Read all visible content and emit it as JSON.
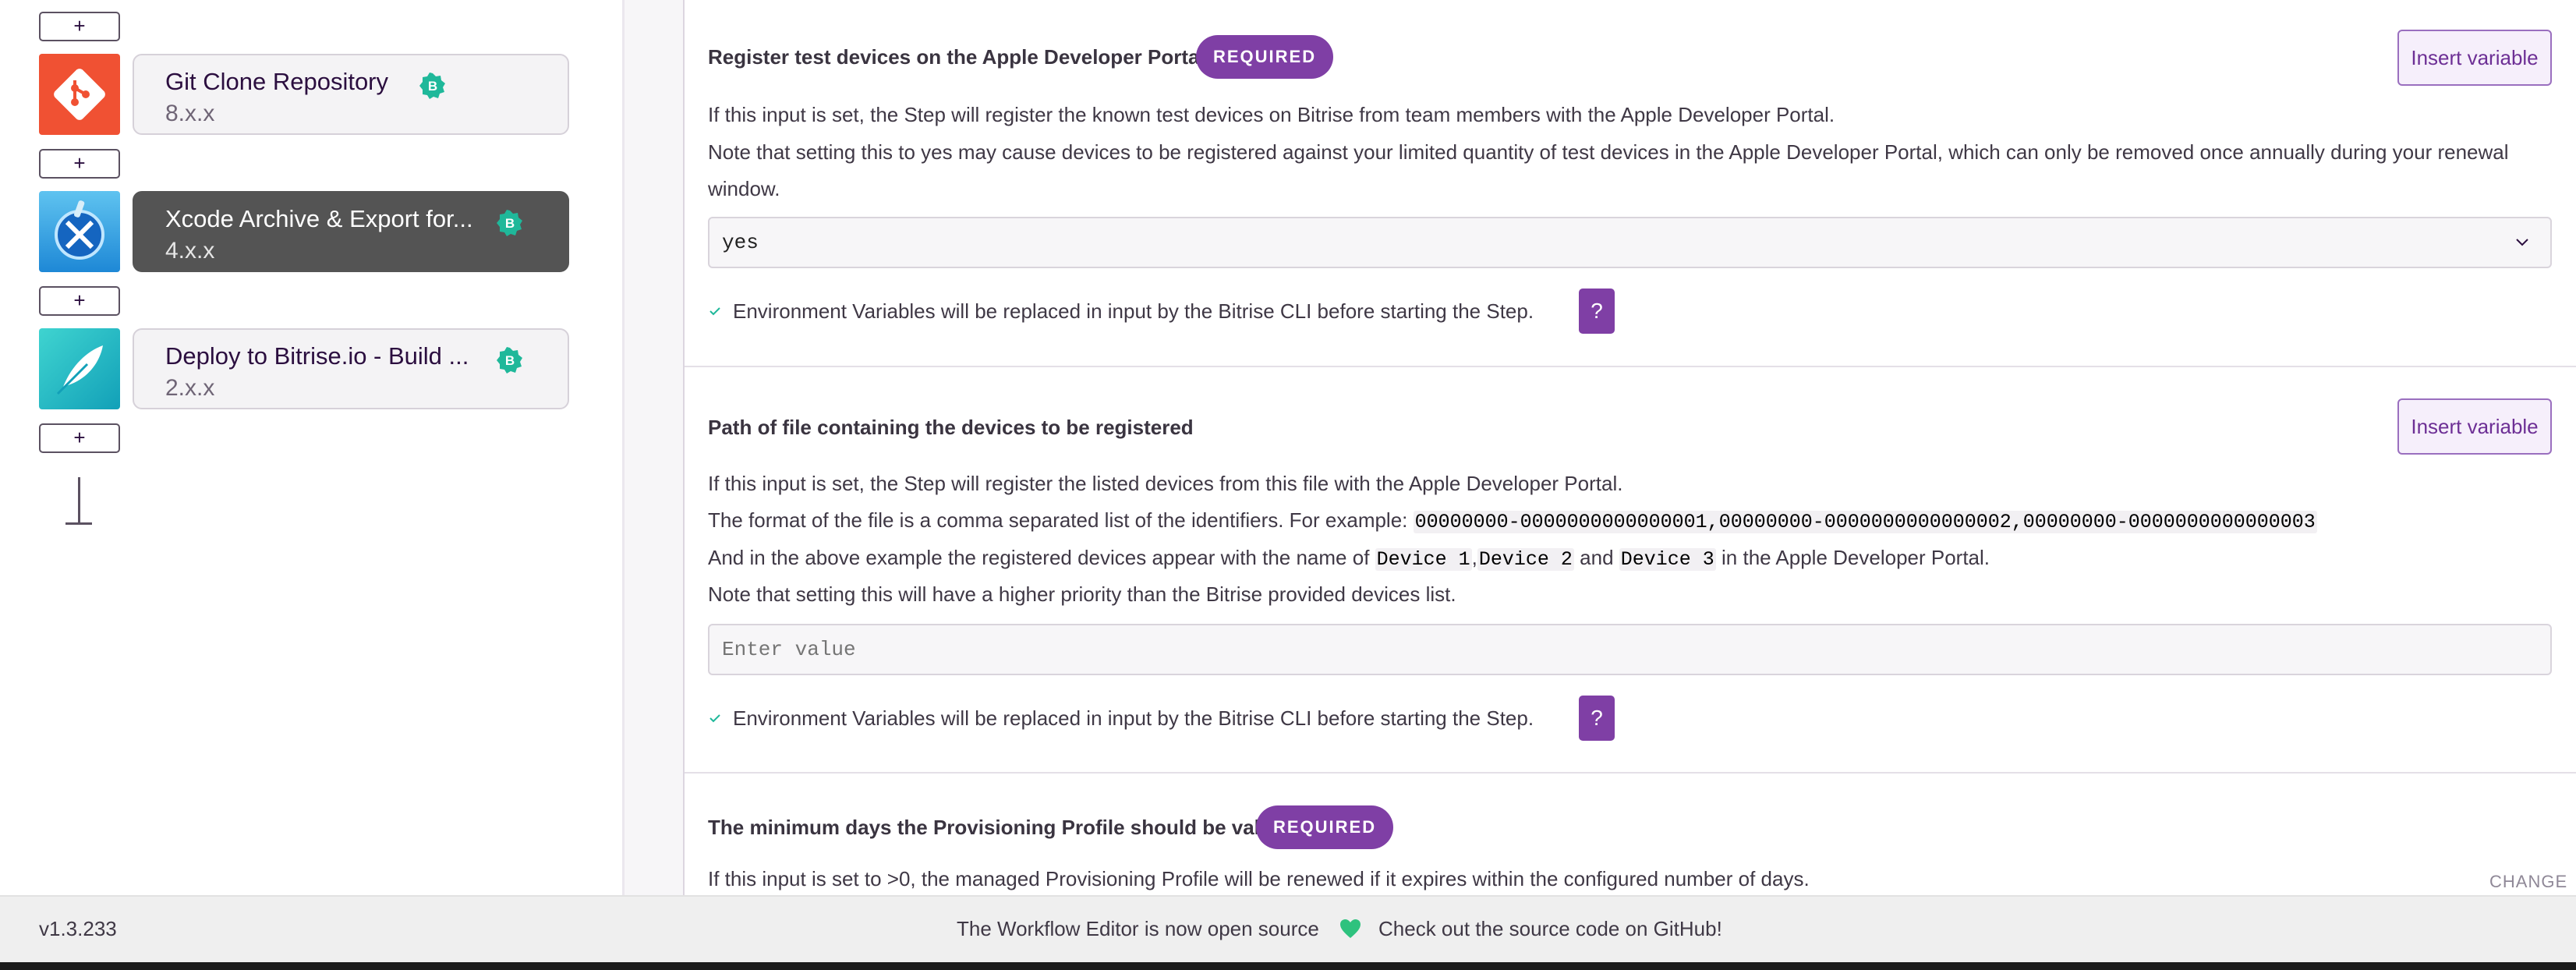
{
  "workflow": {
    "add_label": "+",
    "steps": [
      {
        "title": "Git Clone Repository",
        "version": "8.x.x",
        "badge": "B",
        "icon": "git-icon"
      },
      {
        "title": "Xcode Archive & Export for...",
        "version": "4.x.x",
        "badge": "B",
        "icon": "xcode-icon"
      },
      {
        "title": "Deploy to Bitrise.io - Build ...",
        "version": "2.x.x",
        "badge": "B",
        "icon": "feather-icon"
      }
    ]
  },
  "inputs": [
    {
      "title": "Register test devices on the Apple Developer Portal",
      "required_label": "REQUIRED",
      "insert_label": "Insert variable",
      "desc": [
        "If this input is set, the Step will register the known test devices on Bitrise from team members with the Apple Developer Portal.",
        "Note that setting this to yes may cause devices to be registered against your limited quantity of test devices in the Apple Developer Portal, which can only be removed once annually during your renewal",
        "window."
      ],
      "value": "yes",
      "env_note": "Environment Variables will be replaced in input by the Bitrise CLI before starting the Step.",
      "help_label": "?"
    },
    {
      "title": "Path of file containing the devices to be registered",
      "insert_label": "Insert variable",
      "desc1": "If this input is set, the Step will register the listed devices from this file with the Apple Developer Portal.",
      "desc2_prefix": "The format of the file is a comma separated list of the identifiers. For example: ",
      "desc2_code": "00000000-0000000000000001,00000000-0000000000000002,00000000-0000000000000003",
      "desc3_prefix": "And in the above example the registered devices appear with the name of ",
      "device1": "Device 1",
      "sep": ",",
      "device2": "Device 2",
      "and": " and ",
      "device3": "Device 3",
      "desc3_suffix": " in the Apple Developer Portal.",
      "desc4": "Note that setting this will have a higher priority than the Bitrise provided devices list.",
      "placeholder": "Enter value",
      "env_note": "Environment Variables will be replaced in input by the Bitrise CLI before starting the Step.",
      "help_label": "?"
    },
    {
      "title": "The minimum days the Provisioning Profile should be valid",
      "required_label": "REQUIRED",
      "desc": "If this input is set to >0, the managed Provisioning Profile will be renewed if it expires within the configured number of days.",
      "change_label": "CHANGE"
    }
  ],
  "footer": {
    "version": "v1.3.233",
    "message": "The Workflow Editor is now open source",
    "link": "Check out the source code on GitHub!"
  },
  "colors": {
    "accent": "#7f3fa5",
    "selected_card": "#545454",
    "badge_green": "#1fb89a",
    "git_orange": "#f05133",
    "heart_green": "#2ec27e"
  }
}
